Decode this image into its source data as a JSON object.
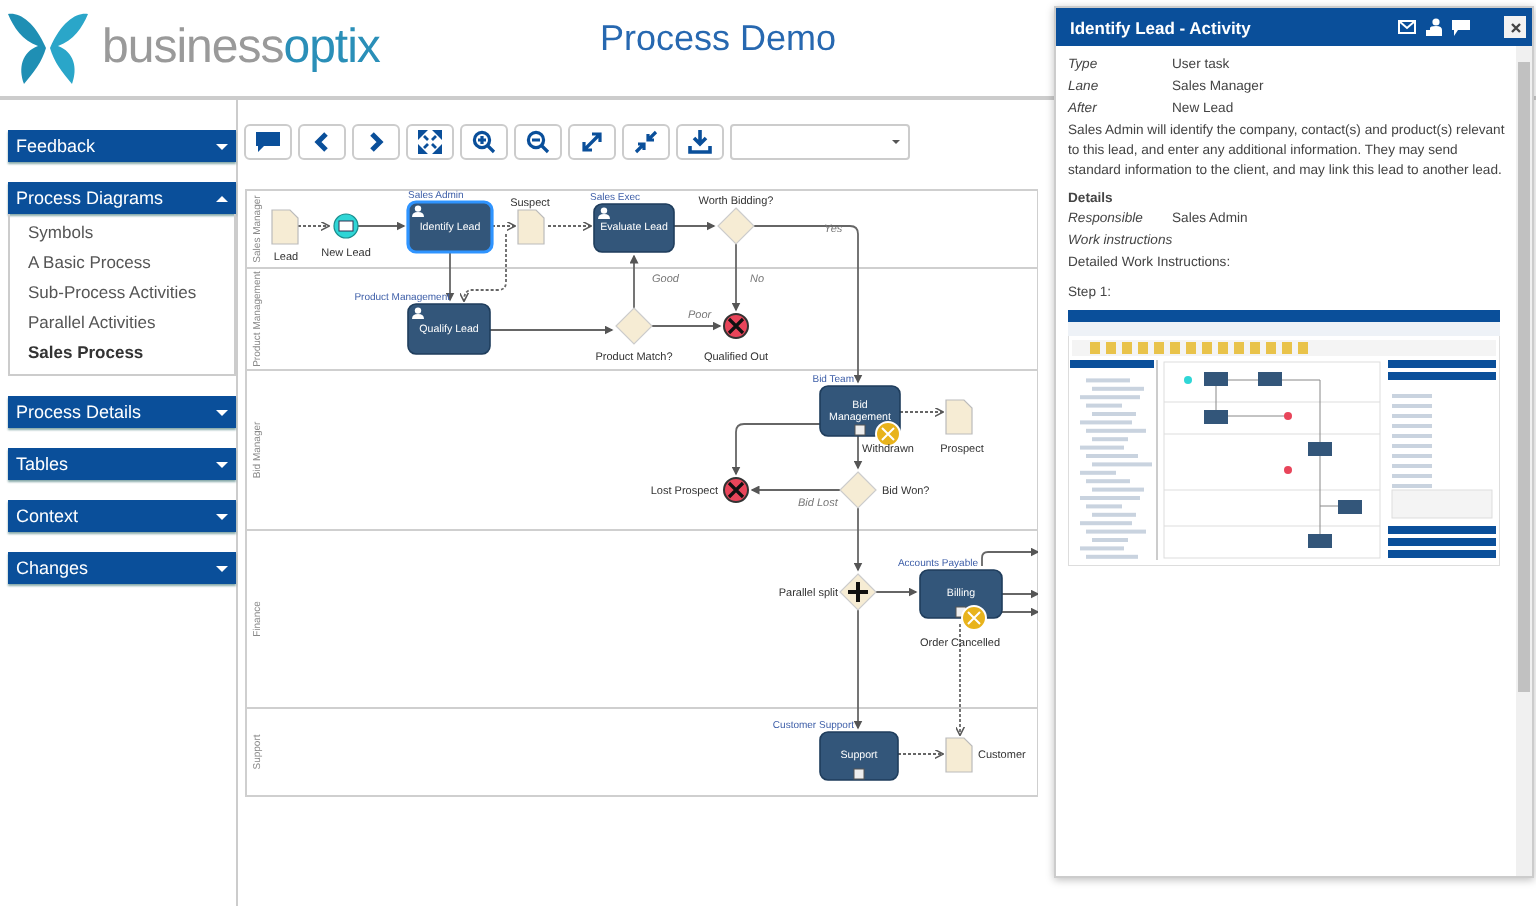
{
  "header": {
    "logo": [
      "business",
      "optix"
    ],
    "title": "Process Demo"
  },
  "sidebar": {
    "panels": [
      {
        "label": "Feedback",
        "expanded": false
      },
      {
        "label": "Process Diagrams",
        "expanded": true,
        "items": [
          {
            "label": "Symbols",
            "selected": false
          },
          {
            "label": "A Basic Process",
            "selected": false
          },
          {
            "label": "Sub-Process Activities",
            "selected": false
          },
          {
            "label": "Parallel Activities",
            "selected": false
          },
          {
            "label": "Sales Process",
            "selected": true
          }
        ]
      },
      {
        "label": "Process Details",
        "expanded": false
      },
      {
        "label": "Tables",
        "expanded": false
      },
      {
        "label": "Context",
        "expanded": false
      },
      {
        "label": "Changes",
        "expanded": false
      }
    ]
  },
  "diagram": {
    "lanes": [
      {
        "label": "Sales Manager"
      },
      {
        "label": "Product Management"
      },
      {
        "label": "Bid Manager"
      },
      {
        "label": "Finance"
      },
      {
        "label": "Support"
      }
    ],
    "nodes": [
      {
        "kind": "document",
        "label": "Lead"
      },
      {
        "kind": "message-start",
        "label": "New Lead"
      },
      {
        "kind": "user-task",
        "label": "Identify Lead",
        "role": "Sales Admin",
        "selected": true
      },
      {
        "kind": "document",
        "label": "Suspect"
      },
      {
        "kind": "user-task",
        "label": "Evaluate Lead",
        "role": "Sales Exec",
        "selected": false
      },
      {
        "kind": "gateway",
        "label": "Worth Bidding?"
      },
      {
        "kind": "user-task",
        "label": "Qualify Lead",
        "role": "Product Management",
        "selected": false
      },
      {
        "kind": "gateway",
        "label": "Product Match?"
      },
      {
        "kind": "error-end",
        "label": "Qualified Out"
      },
      {
        "kind": "subprocess",
        "label": "Bid Management",
        "role": "Bid Team",
        "selected": false
      },
      {
        "kind": "boundary",
        "label": "Withdrawn"
      },
      {
        "kind": "document",
        "label": "Prospect"
      },
      {
        "kind": "error-end",
        "label": "Lost Prospect"
      },
      {
        "kind": "gateway",
        "label": "Bid Won?"
      },
      {
        "kind": "parallel",
        "label": "Parallel split"
      },
      {
        "kind": "subprocess",
        "label": "Billing",
        "role": "Accounts Payable",
        "selected": false
      },
      {
        "kind": "boundary",
        "label": "Order Cancelled"
      },
      {
        "kind": "subprocess",
        "label": "Support",
        "role": "Customer Support",
        "selected": false
      },
      {
        "kind": "document",
        "label": "Customer"
      }
    ],
    "flow_labels": [
      {
        "label": "Yes"
      },
      {
        "label": "No"
      },
      {
        "label": "Good"
      },
      {
        "label": "Poor"
      },
      {
        "label": "Bid Lost"
      }
    ]
  },
  "detail_panel": {
    "title": "Identify Lead - Activity",
    "fields": [
      {
        "label": "Type",
        "value": "User task"
      },
      {
        "label": "Lane",
        "value": "Sales Manager"
      },
      {
        "label": "After",
        "value": "New Lead"
      }
    ],
    "description": "Sales Admin will identify the company, contact(s) and product(s) relevant to this lead, and enter any additional information. They may send standard information to the client, and may link this lead to another lead.",
    "details_heading": "Details",
    "detail_fields": [
      {
        "label": "Responsible",
        "value": "Sales Admin"
      }
    ],
    "work_instructions_heading": "Work instructions",
    "instructions_intro": "Detailed Work Instructions:",
    "step": "Step 1:"
  }
}
